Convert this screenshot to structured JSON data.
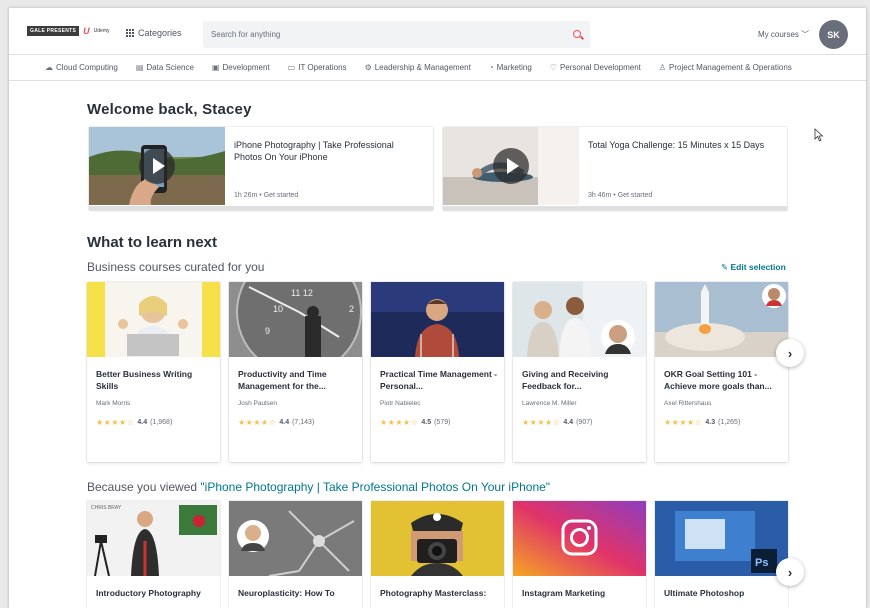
{
  "header": {
    "logo_text": "GALE PRESENTS",
    "logo_brand": "Udemy",
    "categories_label": "Categories",
    "search_placeholder": "Search for anything",
    "my_courses_label": "My courses",
    "avatar_initials": "SK"
  },
  "category_bar": [
    {
      "label": "Cloud Computing",
      "icon": "cloud-icon"
    },
    {
      "label": "Data Science",
      "icon": "chart-icon"
    },
    {
      "label": "Development",
      "icon": "code-icon"
    },
    {
      "label": "IT Operations",
      "icon": "monitor-icon"
    },
    {
      "label": "Leadership & Management",
      "icon": "gear-icon"
    },
    {
      "label": "Marketing",
      "icon": "megaphone-icon"
    },
    {
      "label": "Personal Development",
      "icon": "heart-icon"
    },
    {
      "label": "Project Management & Operations",
      "icon": "person-icon"
    }
  ],
  "welcome": {
    "heading": "Welcome back, Stacey",
    "courses": [
      {
        "title": "iPhone Photography | Take Professional Photos On Your iPhone",
        "meta": "1h 26m • Get started"
      },
      {
        "title": "Total Yoga Challenge: 15 Minutes x 15 Days",
        "meta": "3h 46m • Get started"
      }
    ]
  },
  "learn_next": {
    "heading": "What to learn next",
    "subheading": "Business courses curated for you",
    "edit_label": "Edit selection",
    "cards": [
      {
        "title": "Better Business Writing Skills",
        "author": "Mark Morris",
        "rating": "4.4",
        "count": "(1,968)",
        "stars": "★★★★☆"
      },
      {
        "title": "Productivity and Time Management for the...",
        "author": "Josh Paulsen",
        "rating": "4.4",
        "count": "(7,143)",
        "stars": "★★★★☆"
      },
      {
        "title": "Practical Time Management - Personal...",
        "author": "Piotr Nabielec",
        "rating": "4.5",
        "count": "(579)",
        "stars": "★★★★☆"
      },
      {
        "title": "Giving and Receiving Feedback for...",
        "author": "Lawrence M. Miller",
        "rating": "4.4",
        "count": "(907)",
        "stars": "★★★★☆"
      },
      {
        "title": "OKR Goal Setting 101 - Achieve more goals than...",
        "author": "Axel Rittershaus",
        "rating": "4.3",
        "count": "(1,265)",
        "stars": "★★★★☆"
      }
    ]
  },
  "because_viewed": {
    "prefix": "Because you viewed ",
    "course_link": "\"iPhone Photography | Take Professional Photos On Your iPhone\"",
    "cards": [
      {
        "title": "Introductory Photography"
      },
      {
        "title": "Neuroplasticity: How To"
      },
      {
        "title": "Photography Masterclass:"
      },
      {
        "title": "Instagram Marketing"
      },
      {
        "title": "Ultimate Photoshop"
      }
    ]
  },
  "colors": {
    "accent": "#ec5252",
    "link": "#007791",
    "star": "#f4c150"
  }
}
